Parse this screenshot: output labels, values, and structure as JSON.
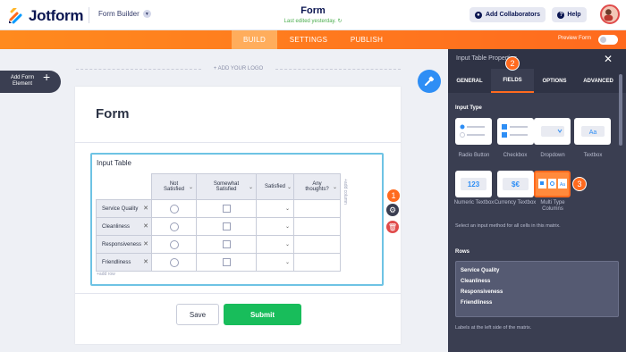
{
  "header": {
    "logo_text": "Jotform",
    "form_builder_label": "Form Builder",
    "form_title": "Form",
    "last_edited": "Last edited yesterday.",
    "add_collaborators": "Add Collaborators",
    "help": "Help"
  },
  "tabs": {
    "build": "BUILD",
    "settings": "SETTINGS",
    "publish": "PUBLISH",
    "preview_form": "Preview Form"
  },
  "left": {
    "add_form_element": "Add Form Element",
    "add_your_logo": "+ ADD YOUR LOGO"
  },
  "form": {
    "heading": "Form",
    "question_label": "Input Table",
    "columns": [
      "Not Satisfied",
      "Somewhat Satisfied",
      "Satisfied",
      "Any thoughts?"
    ],
    "rows": [
      "Service Quality",
      "Cleanliness",
      "Responsiveness",
      "Friendliness"
    ],
    "add_column": "+add column",
    "add_row": "+add row",
    "save_button": "Save",
    "submit_button": "Submit"
  },
  "badges": {
    "one": "1",
    "two": "2",
    "three": "3"
  },
  "panel": {
    "title": "Input Table Properties",
    "tabs": [
      "GENERAL",
      "FIELDS",
      "OPTIONS",
      "ADVANCED"
    ],
    "active_tab": "FIELDS",
    "input_type_heading": "Input Type",
    "input_types": [
      "Radio Button",
      "Checkbox",
      "Dropdown",
      "Textbox",
      "Numeric Textbox",
      "Currency Textbox",
      "Multi Type Columns"
    ],
    "selected_input_type": "Multi Type Columns",
    "input_hint": "Select an input method for all cells in this matrix.",
    "rows_heading": "Rows",
    "rows_values": [
      "Service Quality",
      "Cleanliness",
      "Responsiveness",
      "Friendliness"
    ],
    "rows_hint": "Labels at the left side of the matrix."
  },
  "colors": {
    "orange": "#ff6a1e",
    "submit_green": "#18bd5b",
    "panel_bg": "#3a3e51",
    "selection_blue": "#6ec3e4"
  }
}
